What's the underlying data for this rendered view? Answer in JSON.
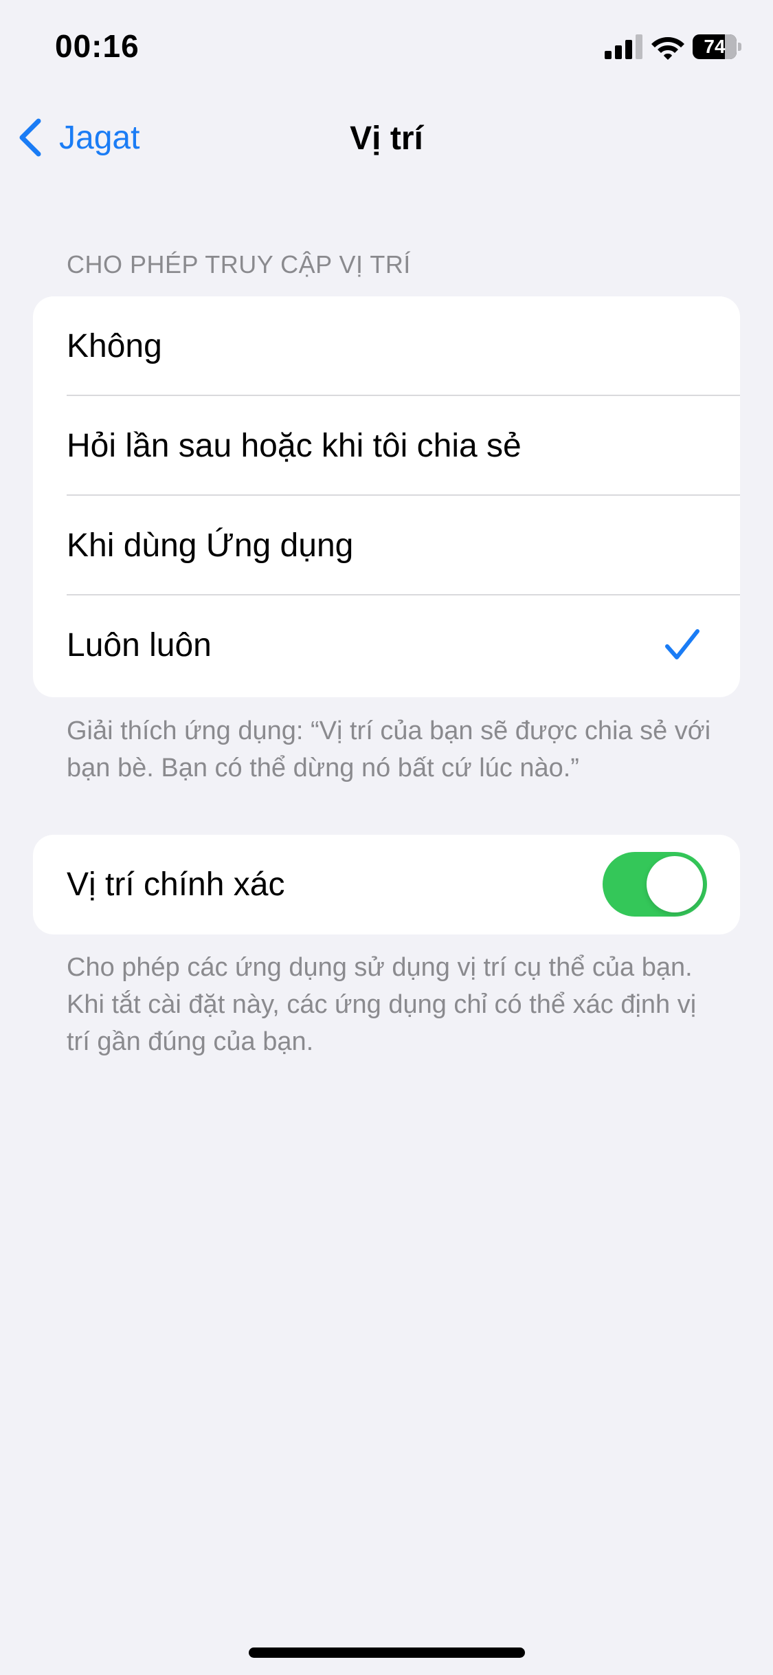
{
  "status_bar": {
    "time": "00:16",
    "battery_level": "74",
    "battery_fraction": 0.74,
    "icons": [
      "signal-icon",
      "wifi-icon",
      "battery-icon"
    ]
  },
  "nav": {
    "back_label": "Jagat",
    "title": "Vị trí"
  },
  "access_section": {
    "header": "CHO PHÉP TRUY CẬP VỊ TRÍ",
    "options": [
      {
        "label": "Không",
        "selected": false
      },
      {
        "label": "Hỏi lần sau hoặc khi tôi chia sẻ",
        "selected": false
      },
      {
        "label": "Khi dùng Ứng dụng",
        "selected": false
      },
      {
        "label": "Luôn luôn",
        "selected": true
      }
    ],
    "footer": "Giải thích ứng dụng: “Vị trí của bạn sẽ được chia sẻ với bạn bè. Bạn có thể dừng nó bất cứ lúc nào.”"
  },
  "precise_section": {
    "label": "Vị trí chính xác",
    "enabled": true,
    "footer": "Cho phép các ứng dụng sử dụng vị trí cụ thể của bạn. Khi tắt cài đặt này, các ứng dụng chỉ có thể xác định vị trí gần đúng của bạn."
  },
  "colors": {
    "accent": "#1A7CF5",
    "toggle_on": "#34C759",
    "background": "#F2F2F7",
    "secondary_text": "#8A8A8E"
  }
}
